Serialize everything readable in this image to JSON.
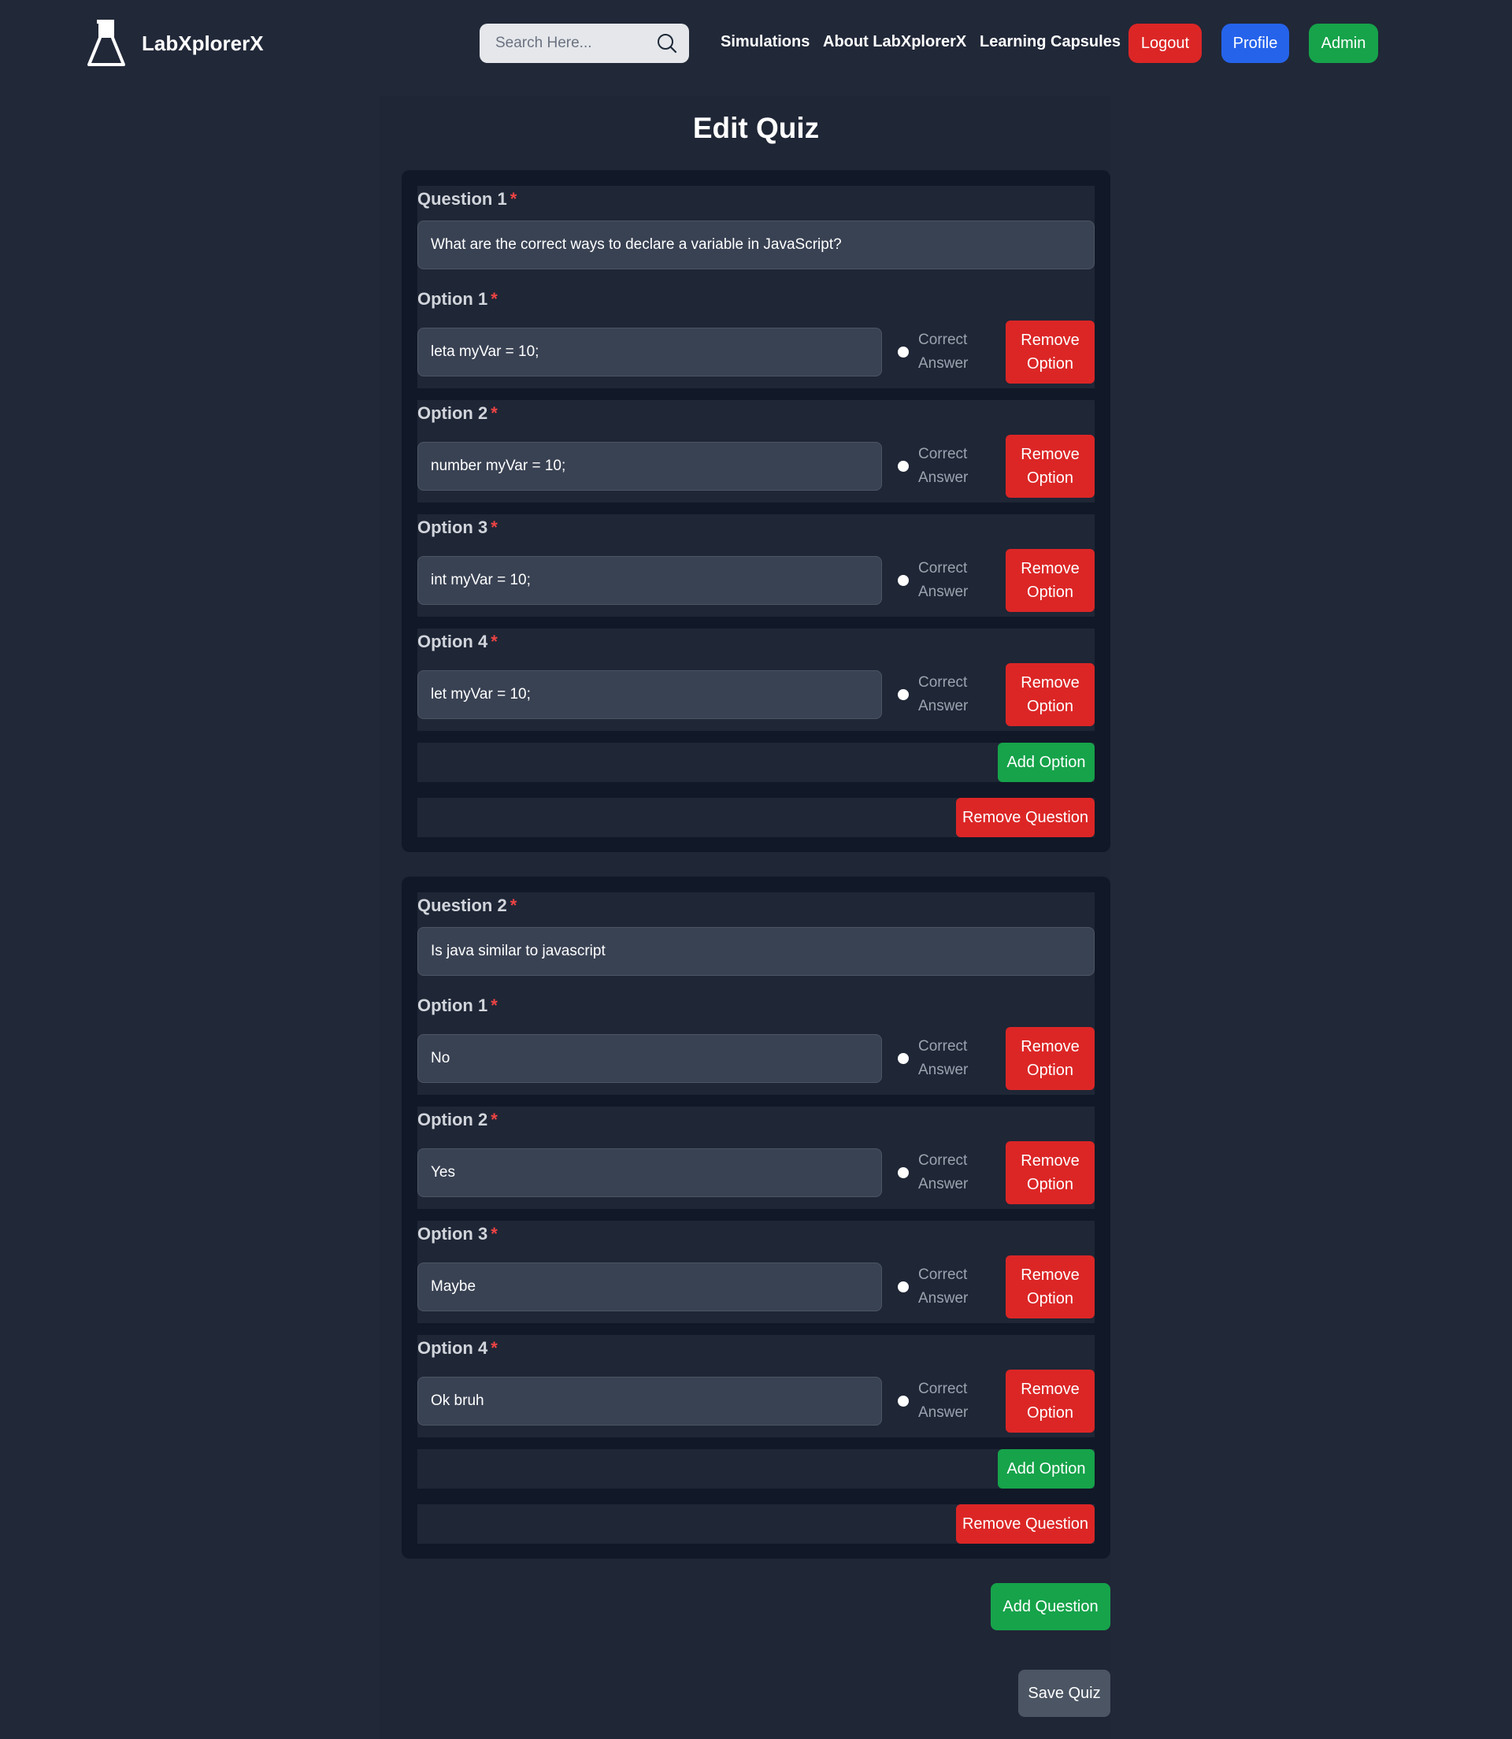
{
  "app": {
    "name": "LabXplorerX",
    "logo_icon": "flask-icon"
  },
  "search": {
    "placeholder": "Search Here..."
  },
  "nav": {
    "links": [
      "Simulations",
      "About LabXplorerX",
      "Learning Capsules"
    ],
    "logout": "Logout",
    "profile": "Profile",
    "admin": "Admin"
  },
  "colors": {
    "danger": "#dc2626",
    "primary": "#2563eb",
    "success": "#16a34a"
  },
  "page": {
    "title": "Edit Quiz"
  },
  "required_marker": "*",
  "correct_answer_label": [
    "Correct",
    "Answer"
  ],
  "remove_option_label": [
    "Remove",
    "Option"
  ],
  "add_option_label": "Add Option",
  "remove_question_label": "Remove Question",
  "questions": [
    {
      "label": "Question 1",
      "text": "What are the correct ways to declare a variable in JavaScript?",
      "options": [
        {
          "label": "Option 1",
          "value": "leta myVar = 10;"
        },
        {
          "label": "Option 2",
          "value": "number myVar = 10;"
        },
        {
          "label": "Option 3",
          "value": "int myVar = 10;"
        },
        {
          "label": "Option 4",
          "value": "let myVar = 10;"
        }
      ]
    },
    {
      "label": "Question 2",
      "text": "Is java similar to javascript",
      "options": [
        {
          "label": "Option 1",
          "value": "No"
        },
        {
          "label": "Option 2",
          "value": "Yes"
        },
        {
          "label": "Option 3",
          "value": "Maybe"
        },
        {
          "label": "Option 4",
          "value": "Ok bruh"
        }
      ]
    }
  ],
  "actions": {
    "add_question": "Add Question",
    "save_quiz": "Save Quiz"
  }
}
